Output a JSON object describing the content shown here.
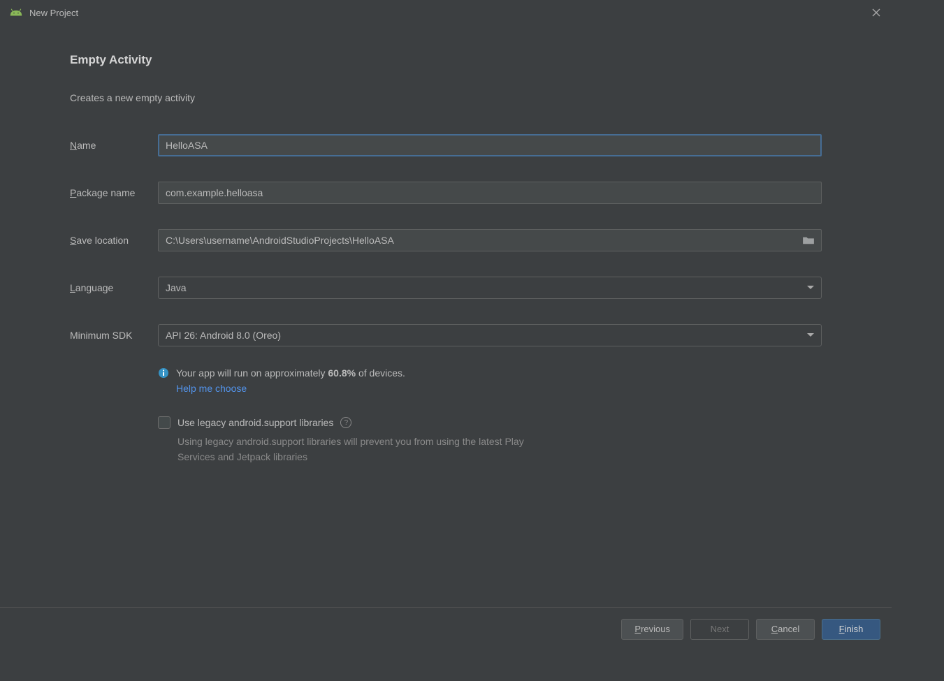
{
  "titlebar": {
    "title": "New Project"
  },
  "form": {
    "heading": "Empty Activity",
    "subtitle": "Creates a new empty activity",
    "name": {
      "label_pre": "N",
      "label_post": "ame",
      "value": "HelloASA"
    },
    "package": {
      "label_pre": "P",
      "label_post": "ackage name",
      "value": "com.example.helloasa"
    },
    "location": {
      "label_pre": "S",
      "label_post": "ave location",
      "value": "C:\\Users\\username\\AndroidStudioProjects\\HelloASA"
    },
    "language": {
      "label_pre": "L",
      "label_post": "anguage",
      "value": "Java"
    },
    "min_sdk": {
      "label": "Minimum SDK",
      "value": "API 26: Android 8.0 (Oreo)"
    }
  },
  "info": {
    "prefix": "Your app will run on approximately ",
    "percent": "60.8%",
    "suffix": " of devices.",
    "help_link": "Help me choose"
  },
  "checkbox": {
    "label": "Use legacy android.support libraries",
    "description": "Using legacy android.support libraries will prevent you from using the latest Play Services and Jetpack libraries"
  },
  "footer": {
    "previous_pre": "P",
    "previous_post": "revious",
    "next": "Next",
    "cancel_pre": "C",
    "cancel_post": "ancel",
    "finish_pre": "F",
    "finish_post": "inish"
  }
}
